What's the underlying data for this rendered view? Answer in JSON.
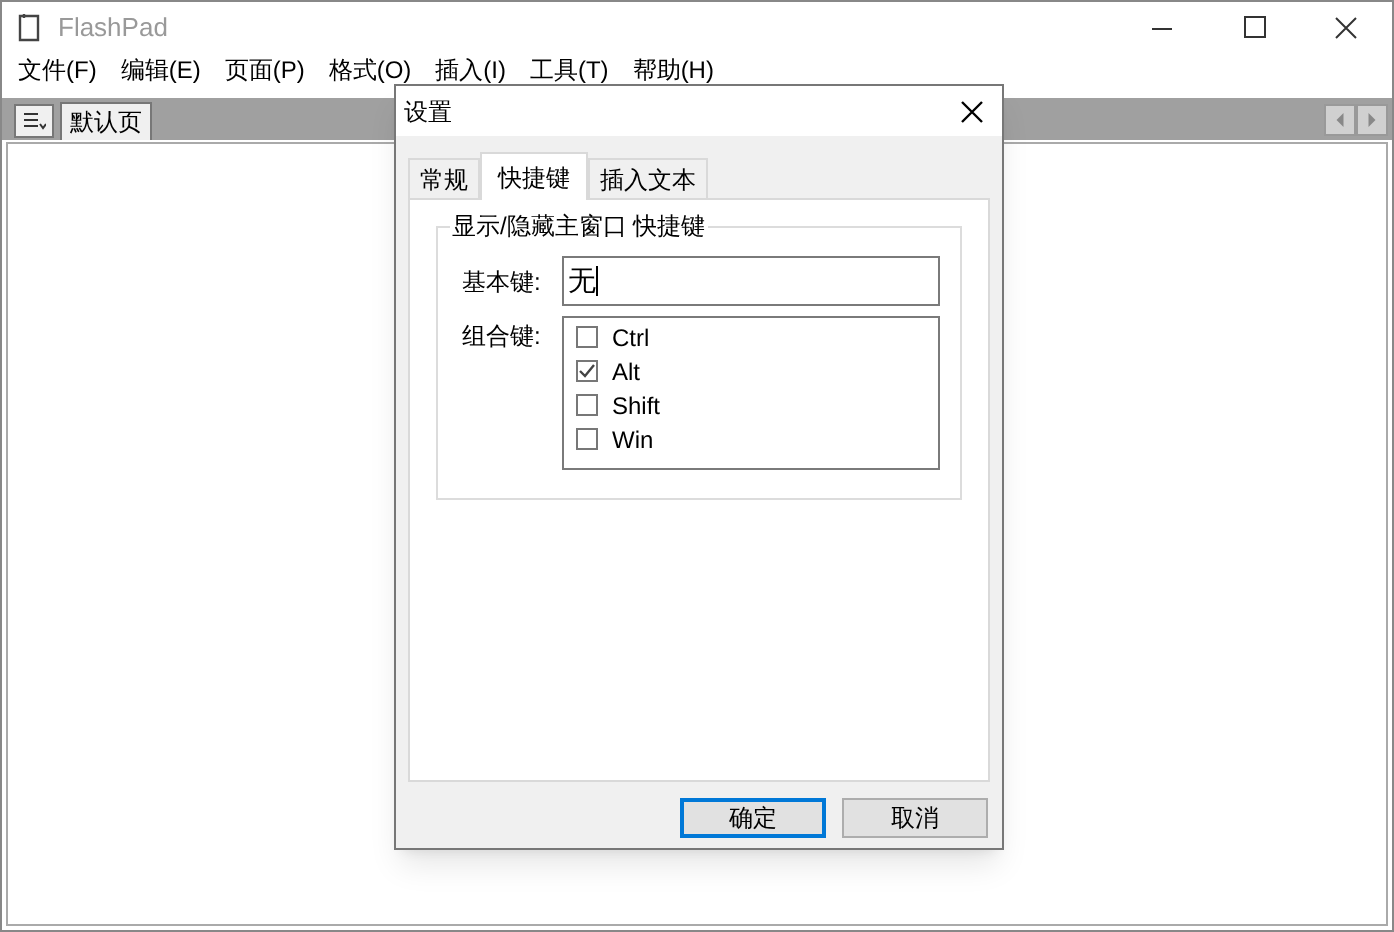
{
  "window": {
    "title": "FlashPad"
  },
  "menu": [
    "文件(F)",
    "编辑(E)",
    "页面(P)",
    "格式(O)",
    "插入(I)",
    "工具(T)",
    "帮助(H)"
  ],
  "page_tabs": [
    {
      "label": "默认页",
      "selected": true
    }
  ],
  "dialog": {
    "title": "设置",
    "tabs": [
      {
        "label": "常规",
        "selected": false
      },
      {
        "label": "快捷键",
        "selected": true
      },
      {
        "label": "插入文本",
        "selected": false
      }
    ],
    "group": {
      "title": "显示/隐藏主窗口 快捷键",
      "base_key_label": "基本键:",
      "base_key_value": "无",
      "modifiers_label": "组合键:",
      "modifiers": [
        {
          "label": "Ctrl",
          "checked": false
        },
        {
          "label": "Alt",
          "checked": true
        },
        {
          "label": "Shift",
          "checked": false
        },
        {
          "label": "Win",
          "checked": false
        }
      ]
    },
    "buttons": [
      {
        "label": "确定",
        "default": true
      },
      {
        "label": "取消",
        "default": false
      }
    ]
  }
}
